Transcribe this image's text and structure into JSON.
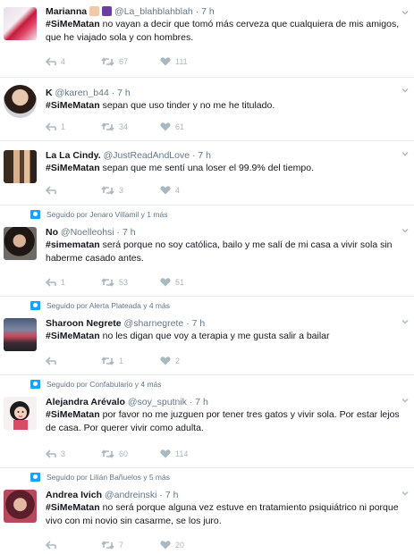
{
  "tweets": [
    {
      "social": "",
      "name": "Marianna",
      "handle": "@La_blahblahblah",
      "time": "7 h",
      "hashtag": "#SiMeMatan",
      "text": " no vayan a decir que tomó más cerveza que cualquiera de mis amigos, que he viajado sola y con hombres.",
      "replies": "4",
      "retweets": "67",
      "likes": "111"
    },
    {
      "social": "",
      "name": "K",
      "handle": "@karen_b44",
      "time": "7 h",
      "hashtag": "#SiMeMatan",
      "text": " sepan que uso tinder y no me he titulado.",
      "replies": "1",
      "retweets": "34",
      "likes": "61"
    },
    {
      "social": "",
      "name": "La La Cindy.",
      "handle": "@JustReadAndLove",
      "time": "7 h",
      "hashtag": "#SiMeMatan",
      "text": " sepan que me sentí una loser el 99.9% del tiempo.",
      "replies": "",
      "retweets": "3",
      "likes": "4"
    },
    {
      "social": "Seguido por Jenaro Villamil y 1 más",
      "name": "No",
      "handle": "@Noelleohsi",
      "time": "7 h",
      "hashtag": "#simematan",
      "text": " será porque no soy católica, bailo y me salí de mi casa a vivir sola sin haberme casado antes.",
      "replies": "1",
      "retweets": "53",
      "likes": "51"
    },
    {
      "social": "Seguido por Alerta Plateada y 4 más",
      "name": "Sharoon Negrete",
      "handle": "@sharnegrete",
      "time": "7 h",
      "hashtag": "#SiMeMatan",
      "text": " no les digan que voy a terapia y me gusta salir a bailar",
      "replies": "",
      "retweets": "1",
      "likes": "2"
    },
    {
      "social": "Seguido por Confabulario y 4 más",
      "name": "Alejandra Arévalo",
      "handle": "@soy_sputnik",
      "time": "7 h",
      "hashtag": "#SiMeMatan",
      "text": " por favor no me juzguen por tener tres gatos y vivir sola. Por estar lejos de casa. Por querer vivir como adulta.",
      "replies": "3",
      "retweets": "60",
      "likes": "114"
    },
    {
      "social": "Seguido por Lilián Bañuelos y 5 más",
      "name": "Andrea Ivich",
      "handle": "@andreinski",
      "time": "7 h",
      "hashtag": "#SiMeMatan",
      "text": " no será porque alguna vez estuve en tratamiento psiquiátrico ni porque vivo con mi novio sin casarme, se los juro.",
      "replies": "",
      "retweets": "7",
      "likes": "20"
    }
  ],
  "dot": "·",
  "colors": {
    "icon": "#aab8c2",
    "secondary": "#657786",
    "accent": "#1da1f2"
  }
}
